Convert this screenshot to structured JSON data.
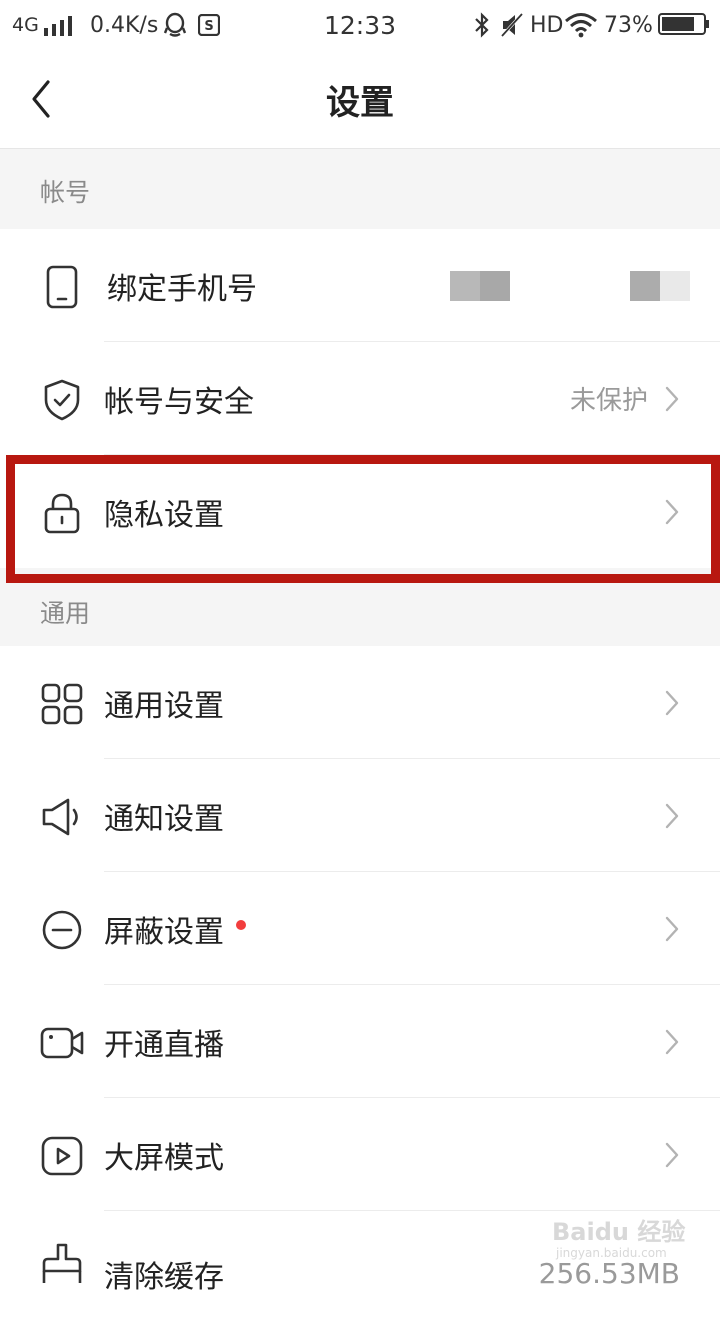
{
  "status_bar": {
    "network": "4G",
    "speed": "0.4K/s",
    "time": "12:33",
    "hd": "HD",
    "battery": "73%"
  },
  "header": {
    "title": "设置"
  },
  "sections": [
    {
      "title": "帐号",
      "items": [
        {
          "label": "绑定手机号",
          "icon": "phone-icon"
        },
        {
          "label": "帐号与安全",
          "value": "未保护",
          "icon": "shield-check-icon"
        },
        {
          "label": "隐私设置",
          "icon": "lock-icon",
          "highlighted": true
        }
      ]
    },
    {
      "title": "通用",
      "items": [
        {
          "label": "通用设置",
          "icon": "grid-icon"
        },
        {
          "label": "通知设置",
          "icon": "speaker-icon"
        },
        {
          "label": "屏蔽设置",
          "icon": "minus-circle-icon",
          "badge": "red-dot"
        },
        {
          "label": "开通直播",
          "icon": "video-camera-icon"
        },
        {
          "label": "大屏模式",
          "icon": "play-screen-icon"
        },
        {
          "label": "清除缓存",
          "value": "256.53MB",
          "icon": "brush-icon"
        }
      ]
    }
  ],
  "watermark": {
    "text": "Baidu 经验",
    "sub": "jingyan.baidu.com"
  },
  "colors": {
    "highlight": "#b81810",
    "section_bg": "#f5f5f5",
    "badge": "#f23d3d"
  }
}
